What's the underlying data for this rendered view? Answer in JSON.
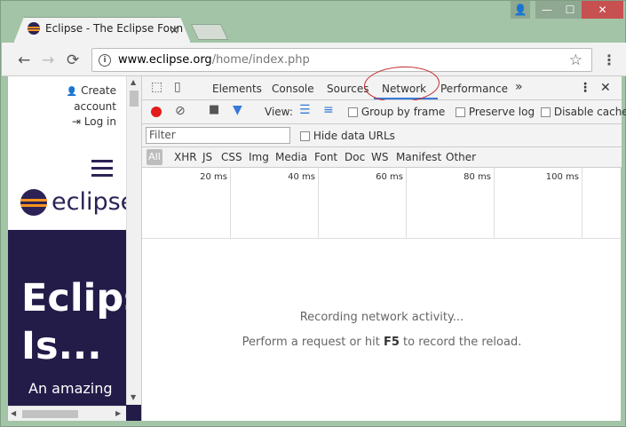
{
  "window": {
    "controls": [
      "user-icon",
      "minimize-icon",
      "maximize-icon",
      "close-icon"
    ],
    "control_glyphs": [
      "👤",
      "—",
      "☐",
      "✕"
    ],
    "bg_color": "#a3c4a6"
  },
  "browser_tab": {
    "title": "Eclipse - The Eclipse Foun",
    "close": "×"
  },
  "toolbar": {
    "back": "←",
    "forward": "→",
    "reload": "⟳",
    "info": "i",
    "url_host": "www.eclipse.org",
    "url_path": "/home/index.php",
    "star": "☆",
    "menu": "⋮"
  },
  "page": {
    "create_account_line1": "Create",
    "create_account_line2": "account",
    "login": "Log in",
    "user_glyph": "👤",
    "login_glyph": "⇥",
    "logo_text": "eclipse",
    "hero_title": "Eclipse\nIs...",
    "hero_sub": "An amazing",
    "brand_color": "#2c2255",
    "accent_color": "#f7941e"
  },
  "devtools": {
    "tabs": [
      "Elements",
      "Console",
      "Sources",
      "Network",
      "Performance"
    ],
    "active_tab": "Network",
    "more": "»",
    "kebab": "⋮",
    "close": "✕",
    "view_label": "View:",
    "group_by_frame": "Group by frame",
    "preserve_log": "Preserve log",
    "disable_cache": "Disable cache",
    "filter_placeholder": "Filter",
    "hide_data_urls": "Hide data URLs",
    "all": "All",
    "types": [
      "XHR",
      "JS",
      "CSS",
      "Img",
      "Media",
      "Font",
      "Doc",
      "WS",
      "Manifest",
      "Other"
    ],
    "timeline_ticks": [
      "20 ms",
      "40 ms",
      "60 ms",
      "80 ms",
      "100 ms"
    ],
    "recording": "Recording network activity...",
    "hint_prefix": "Perform a request or hit ",
    "hint_key": "F5",
    "hint_suffix": " to record the reload.",
    "accent_color": "#3879d9",
    "record_color": "#e31b1b"
  }
}
